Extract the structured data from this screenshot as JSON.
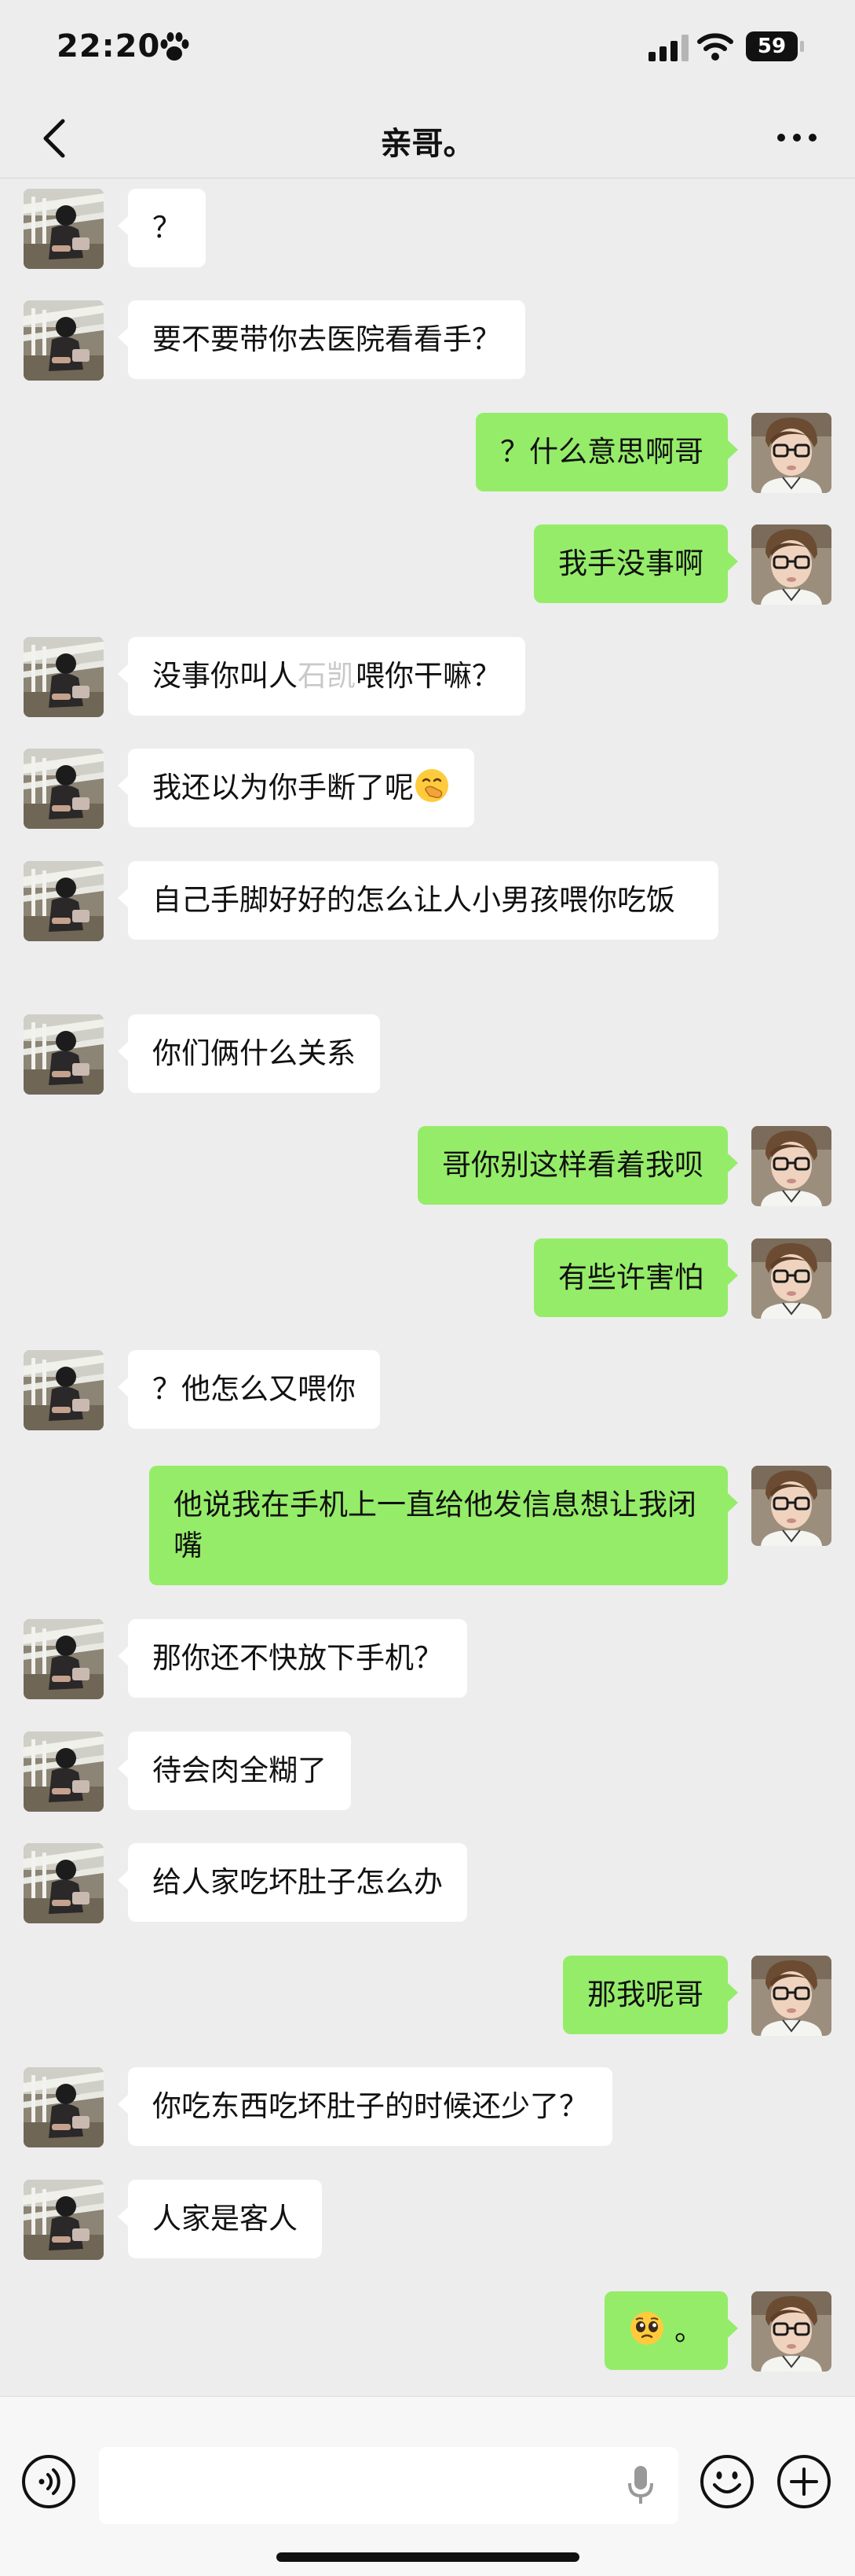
{
  "status": {
    "time": "22:20",
    "battery": "59",
    "paw_icon": "paw-icon"
  },
  "header": {
    "title": "亲哥。",
    "back_icon": "chevron-left-icon",
    "more_icon": "more-icon"
  },
  "messages": [
    {
      "side": "left",
      "text": "？"
    },
    {
      "side": "left",
      "text": "要不要带你去医院看看手？"
    },
    {
      "side": "right",
      "text": "？什么意思啊哥"
    },
    {
      "side": "right",
      "text": "我手没事啊"
    },
    {
      "side": "left",
      "text_before": "没事你叫人",
      "watermark": "石凯",
      "text_after": "喂你干嘛？"
    },
    {
      "side": "left",
      "text": "我还以为你手断了呢",
      "emoji": "face-with-hand-over-mouth-emoji"
    },
    {
      "side": "left",
      "text": "自己手脚好好的怎么让人小男孩喂你吃饭"
    },
    {
      "side": "left",
      "text": "你们俩什么关系"
    },
    {
      "side": "right",
      "text": "哥你别这样看着我呗"
    },
    {
      "side": "right",
      "text": "有些许害怕"
    },
    {
      "side": "left",
      "text": "？他怎么又喂你"
    },
    {
      "side": "right",
      "text": "他说我在手机上一直给他发信息想让我闭嘴"
    },
    {
      "side": "left",
      "text": "那你还不快放下手机？"
    },
    {
      "side": "left",
      "text": "待会肉全糊了"
    },
    {
      "side": "left",
      "text": "给人家吃坏肚子怎么办"
    },
    {
      "side": "right",
      "text": "那我呢哥"
    },
    {
      "side": "left",
      "text": "你吃东西吃坏肚子的时候还少了？"
    },
    {
      "side": "left",
      "text": "人家是客人"
    },
    {
      "side": "right",
      "emoji": "pleading-face-emoji",
      "text": "。"
    }
  ],
  "input": {
    "value": "",
    "voice_icon": "voice-icon",
    "mic_icon": "mic-icon",
    "emoji_icon": "smiley-icon",
    "plus_icon": "plus-circle-icon"
  },
  "colors": {
    "background": "#ededed",
    "incoming_bubble": "#ffffff",
    "outgoing_bubble": "#95ec69"
  }
}
